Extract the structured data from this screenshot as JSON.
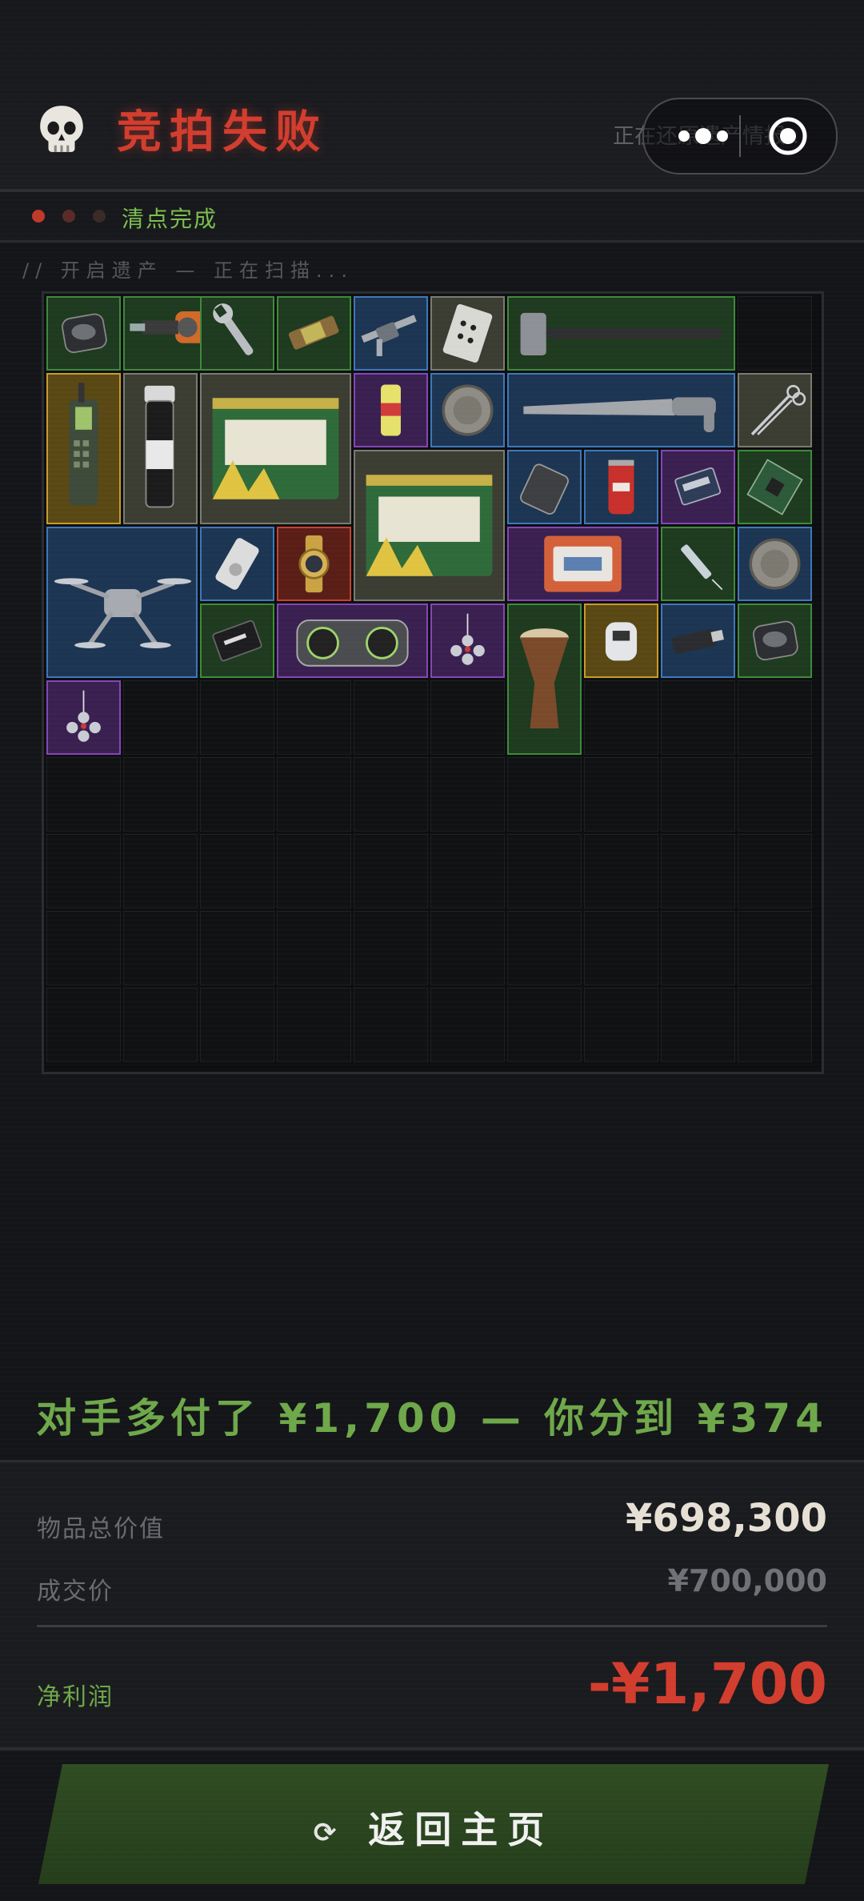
{
  "header": {
    "title": "竞拍失败",
    "status_text": "正在还原遗产情报...",
    "icons": [
      "skull-icon",
      "more-icon",
      "target-icon"
    ]
  },
  "progress": {
    "label": "清点完成",
    "dot_colors": [
      "#c0392b",
      "#5a2a26",
      "#3a2a28"
    ]
  },
  "scan_text": "// 开启遗产 — 正在扫描...",
  "inventory": {
    "columns": 10,
    "rows": 10,
    "items": [
      {
        "name": "wireless-charger-pad",
        "rarity": "green"
      },
      {
        "name": "power-drill",
        "rarity": "green"
      },
      {
        "name": "adjustable-wrench",
        "rarity": "green"
      },
      {
        "name": "energy-bar",
        "rarity": "green"
      },
      {
        "name": "digital-caliper",
        "rarity": "blue"
      },
      {
        "name": "playing-card",
        "rarity": "gray"
      },
      {
        "name": "sledgehammer",
        "rarity": "green"
      },
      {
        "name": "satellite-phone",
        "rarity": "gold"
      },
      {
        "name": "sample-vial",
        "rarity": "gray"
      },
      {
        "name": "emergency-candles-box",
        "rarity": "gray"
      },
      {
        "name": "energy-drink-can",
        "rarity": "purple"
      },
      {
        "name": "old-coin",
        "rarity": "blue"
      },
      {
        "name": "machete",
        "rarity": "blue"
      },
      {
        "name": "surgical-scissors",
        "rarity": "gray"
      },
      {
        "name": "emergency-candles-box",
        "rarity": "gray"
      },
      {
        "name": "power-bank",
        "rarity": "blue"
      },
      {
        "name": "cola-can",
        "rarity": "blue"
      },
      {
        "name": "memory-module",
        "rarity": "purple"
      },
      {
        "name": "circuit-board",
        "rarity": "green"
      },
      {
        "name": "quadcopter-drone",
        "rarity": "blue"
      },
      {
        "name": "mp3-player",
        "rarity": "blue"
      },
      {
        "name": "gold-wristwatch",
        "rarity": "red"
      },
      {
        "name": "edc-kit",
        "rarity": "purple"
      },
      {
        "name": "syringe",
        "rarity": "green"
      },
      {
        "name": "old-coin",
        "rarity": "blue"
      },
      {
        "name": "good-luck-card",
        "rarity": "green"
      },
      {
        "name": "boombox-speaker",
        "rarity": "purple"
      },
      {
        "name": "crystal-ornament",
        "rarity": "purple"
      },
      {
        "name": "djembe-drum",
        "rarity": "green"
      },
      {
        "name": "pulse-oximeter",
        "rarity": "gold"
      },
      {
        "name": "usb-drive",
        "rarity": "blue"
      },
      {
        "name": "wireless-charger-pad",
        "rarity": "green"
      },
      {
        "name": "crystal-ornament",
        "rarity": "purple"
      }
    ]
  },
  "result": {
    "message": "对手多付了 ¥1,700 — 你分到 ¥374"
  },
  "summary": {
    "total_value_label": "物品总价值",
    "total_value": "¥698,300",
    "deal_price_label": "成交价",
    "deal_price": "¥700,000",
    "net_profit_label": "净利润",
    "net_profit": "-¥1,700"
  },
  "colors": {
    "accent_red": "#d23d2e",
    "accent_green": "#6ea84a",
    "loss_red": "#d23d2e",
    "total_value_color": "#e6e0d4",
    "deal_price_color": "#707176"
  },
  "home_button": {
    "label": "返回主页",
    "icon": "refresh-icon"
  }
}
